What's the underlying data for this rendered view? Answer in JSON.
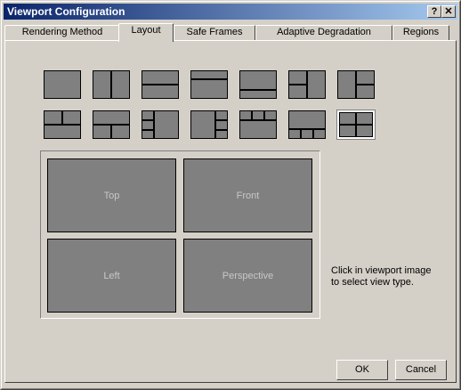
{
  "window": {
    "title": "Viewport Configuration",
    "help_label": "?",
    "close_label": "✕"
  },
  "tabs": [
    {
      "label": "Rendering Method",
      "active": false
    },
    {
      "label": "Layout",
      "active": true
    },
    {
      "label": "Safe Frames",
      "active": false
    },
    {
      "label": "Adaptive Degradation",
      "active": false
    },
    {
      "label": "Regions",
      "active": false
    }
  ],
  "layout": {
    "selected_layout": 14,
    "viewports": [
      "Top",
      "Front",
      "Left",
      "Perspective"
    ],
    "hint": "Click in viewport image to select view type."
  },
  "buttons": {
    "ok": "OK",
    "cancel": "Cancel"
  },
  "colors": {
    "title_start": "#0a246a",
    "title_end": "#a6caf0",
    "face": "#d4d0c8",
    "viewport": "#808080"
  }
}
